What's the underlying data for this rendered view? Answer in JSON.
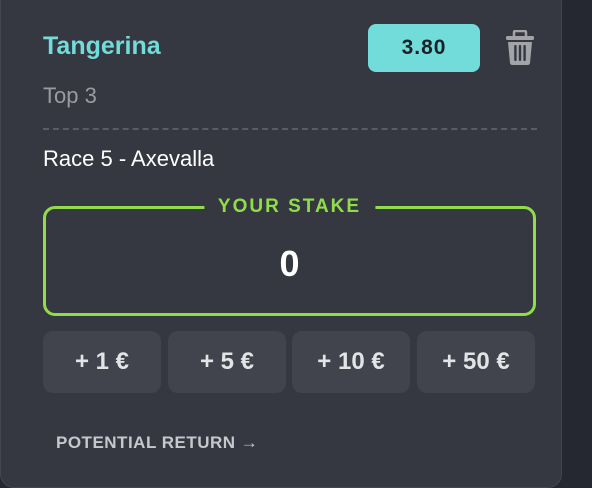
{
  "bet": {
    "selection": "Tangerina",
    "market": "Top 3",
    "odds": "3.80",
    "race": "Race 5 - Axevalla"
  },
  "stake": {
    "label": "YOUR STAKE",
    "value": "0"
  },
  "quick_amounts": [
    "+ 1 €",
    "+ 5 €",
    "+ 10 €",
    "+ 50 €"
  ],
  "potential_return_label": "POTENTIAL RETURN →",
  "colors": {
    "accent_teal": "#72dcda",
    "accent_green": "#90dd49",
    "card_background": "#363841"
  },
  "icons": {
    "delete": "trash-icon"
  }
}
